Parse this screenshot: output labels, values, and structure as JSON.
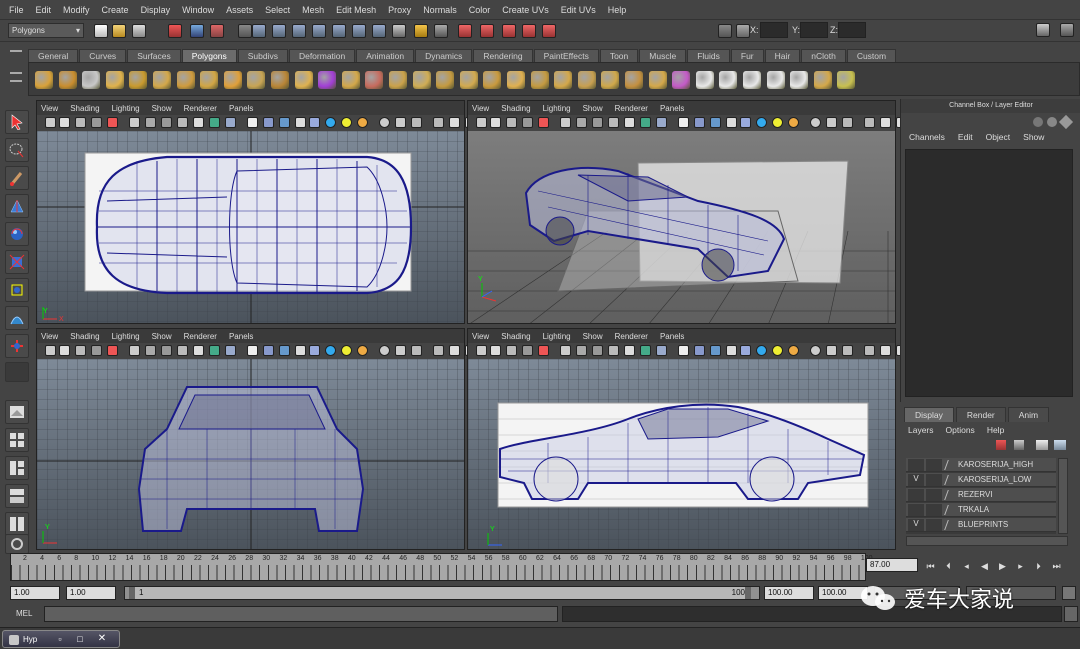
{
  "menu": [
    "File",
    "Edit",
    "Modify",
    "Create",
    "Display",
    "Window",
    "Assets",
    "Select",
    "Mesh",
    "Edit Mesh",
    "Proxy",
    "Normals",
    "Color",
    "Create UVs",
    "Edit UVs",
    "Help"
  ],
  "status": {
    "mode": "Polygons",
    "x_label": "X:",
    "y_label": "Y:",
    "z_label": "Z:"
  },
  "shelf_tabs": [
    "General",
    "Curves",
    "Surfaces",
    "Polygons",
    "Subdivs",
    "Deformation",
    "Animation",
    "Dynamics",
    "Rendering",
    "PaintEffects",
    "Toon",
    "Muscle",
    "Fluids",
    "Fur",
    "Hair",
    "nCloth",
    "Custom"
  ],
  "shelf_active": "Polygons",
  "viewport_menu": [
    "View",
    "Shading",
    "Lighting",
    "Show",
    "Renderer",
    "Panels"
  ],
  "viewports": [
    {
      "name": "top",
      "axis_label": "Y X"
    },
    {
      "name": "persp",
      "axis_label": "Y Z X"
    },
    {
      "name": "front",
      "axis_label": "Y X"
    },
    {
      "name": "side",
      "axis_label": "Y Z"
    }
  ],
  "channel_box": {
    "title": "Channel Box / Layer Editor",
    "menu": [
      "Channels",
      "Edit",
      "Object",
      "Show"
    ]
  },
  "layer_editor": {
    "tabs": [
      "Display",
      "Render",
      "Anim"
    ],
    "active_tab": "Display",
    "menu": [
      "Layers",
      "Options",
      "Help"
    ],
    "layers": [
      {
        "v": "",
        "name": "KAROSERIJA_HIGH"
      },
      {
        "v": "V",
        "name": "KAROSERIJA_LOW"
      },
      {
        "v": "",
        "name": "REZERVI"
      },
      {
        "v": "",
        "name": "TRKALA"
      },
      {
        "v": "V",
        "name": "BLUEPRINTS"
      }
    ]
  },
  "timeline": {
    "ticks": [
      "2",
      "4",
      "6",
      "8",
      "10",
      "12",
      "14",
      "16",
      "18",
      "20",
      "22",
      "24",
      "26",
      "28",
      "30",
      "32",
      "34",
      "36",
      "38",
      "40",
      "42",
      "44",
      "46",
      "48",
      "50",
      "52",
      "54",
      "56",
      "58",
      "60",
      "62",
      "64",
      "66",
      "68",
      "70",
      "72",
      "74",
      "76",
      "78",
      "80",
      "82",
      "84",
      "86",
      "88",
      "90",
      "92",
      "94",
      "96",
      "98",
      "100"
    ],
    "current_frame": "87.00"
  },
  "range": {
    "start": "1.00",
    "start2": "1.00",
    "slider_start": "1",
    "slider_end": "100",
    "end": "100.00",
    "end2": "100.00"
  },
  "cmd": {
    "label": "MEL"
  },
  "taskbar": {
    "label": "Hyp"
  },
  "watermark": "爱车大家说",
  "colors": {
    "wire": "#1a1a8a",
    "bg": "#444444"
  }
}
